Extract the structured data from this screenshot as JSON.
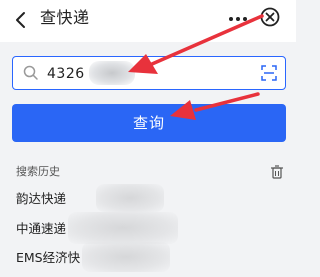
{
  "header": {
    "title": "查快递",
    "back_icon": "chevron-left-icon",
    "more_icon": "more-dots-icon",
    "close_icon": "close-circle-icon"
  },
  "search": {
    "value": "4326",
    "search_icon": "search-icon",
    "scan_icon": "scan-icon"
  },
  "query_button": {
    "label": "查询"
  },
  "history": {
    "title": "搜索历史",
    "delete_icon": "trash-icon",
    "items": [
      {
        "label": "韵达快递"
      },
      {
        "label": "中通速递"
      },
      {
        "label": "EMS经济快"
      }
    ]
  },
  "colors": {
    "accent": "#2a66f5",
    "annotation": "#e8323c"
  }
}
